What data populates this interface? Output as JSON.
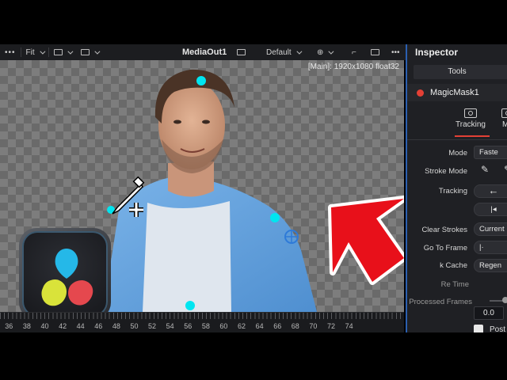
{
  "viewer_toolbar": {
    "fit_label": "Fit",
    "node_name": "MediaOut1",
    "lut_label": "Default"
  },
  "viewer": {
    "resolution_label": "[Main]: 1920x1080 float32"
  },
  "ruler": {
    "numbers": [
      "36",
      "38",
      "40",
      "42",
      "44",
      "46",
      "48",
      "50",
      "52",
      "54",
      "56",
      "58",
      "60",
      "62",
      "64",
      "66",
      "68",
      "70",
      "72",
      "74"
    ]
  },
  "inspector": {
    "title": "Inspector",
    "tools_tab": "Tools",
    "node": {
      "name": "MagicMask1",
      "color": "#e44035"
    },
    "tabs": [
      {
        "label": "Tracking"
      },
      {
        "label": "Ma"
      }
    ],
    "rows": {
      "mode": {
        "label": "Mode",
        "value": "Faste"
      },
      "stroke_mode": {
        "label": "Stroke Mode"
      },
      "tracking": {
        "label": "Tracking"
      },
      "clear_strokes": {
        "label": "Clear Strokes",
        "value": "Current"
      },
      "go_to_frame": {
        "label": "Go To Frame"
      },
      "cache": {
        "label": "k Cache",
        "value": "Regen"
      },
      "reference_time": {
        "label": "Re          Time"
      },
      "processed_frames": {
        "label": "Processed Frames"
      },
      "number_value": "0.0",
      "post_label": "Post"
    }
  },
  "colors": {
    "accent_blue": "#2b5fb0",
    "arrow_red": "#e8101a",
    "tracker_cyan": "#00e5f0"
  }
}
